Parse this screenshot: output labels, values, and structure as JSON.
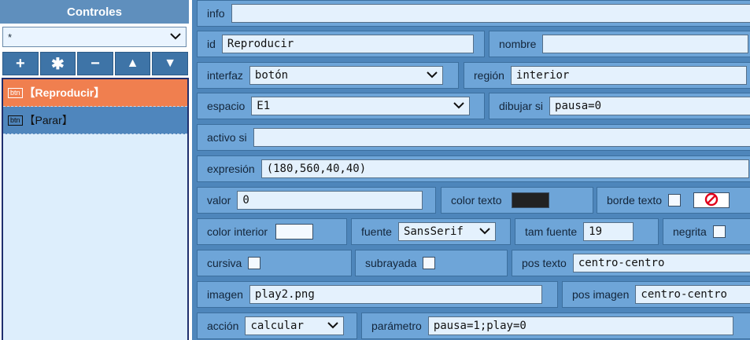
{
  "sidebar": {
    "title": "Controles",
    "filter_value": "*",
    "toolbar": {
      "add": "+",
      "duplicate": "✱",
      "remove": "−",
      "up": "▲",
      "down": "▼"
    },
    "items": [
      {
        "tag": "btn",
        "label": "【Reproducir】",
        "selected": true
      },
      {
        "tag": "btn",
        "label": "【Parar】",
        "selected": false
      }
    ]
  },
  "form": {
    "info": {
      "label": "info",
      "value": ""
    },
    "id": {
      "label": "id",
      "value": "Reproducir"
    },
    "nombre": {
      "label": "nombre",
      "value": ""
    },
    "interfaz": {
      "label": "interfaz",
      "value": "botón"
    },
    "region": {
      "label": "región",
      "value": "interior"
    },
    "espacio": {
      "label": "espacio",
      "value": "E1"
    },
    "dibujar_si": {
      "label": "dibujar si",
      "value": "pausa=0"
    },
    "activo_si": {
      "label": "activo si",
      "value": ""
    },
    "expresion": {
      "label": "expresión",
      "value": "(180,560,40,40)"
    },
    "valor": {
      "label": "valor",
      "value": "0"
    },
    "color_texto": {
      "label": "color texto",
      "color": "#222222"
    },
    "borde_texto": {
      "label": "borde texto",
      "checked": false,
      "no_color_icon": "no-color-icon"
    },
    "color_interior": {
      "label": "color interior",
      "color": "#f4f9ff"
    },
    "fuente": {
      "label": "fuente",
      "value": "SansSerif"
    },
    "tam_fuente": {
      "label": "tam fuente",
      "value": "19"
    },
    "negrita": {
      "label": "negrita",
      "checked": false
    },
    "cursiva": {
      "label": "cursiva",
      "checked": false
    },
    "subrayada": {
      "label": "subrayada",
      "checked": false
    },
    "pos_texto": {
      "label": "pos texto",
      "value": "centro-centro"
    },
    "imagen": {
      "label": "imagen",
      "value": "play2.png"
    },
    "pos_imagen": {
      "label": "pos imagen",
      "value": "centro-centro"
    },
    "accion": {
      "label": "acción",
      "value": "calcular"
    },
    "parametro": {
      "label": "parámetro",
      "value": "pausa=1;play=0"
    }
  },
  "colors": {
    "header": "#5f8fbd",
    "panel": "#4e86bb",
    "cell": "#6ea5d8",
    "selected_item": "#f07f4f",
    "field": "#e4f1fd",
    "no_color_red": "#e0001a"
  }
}
